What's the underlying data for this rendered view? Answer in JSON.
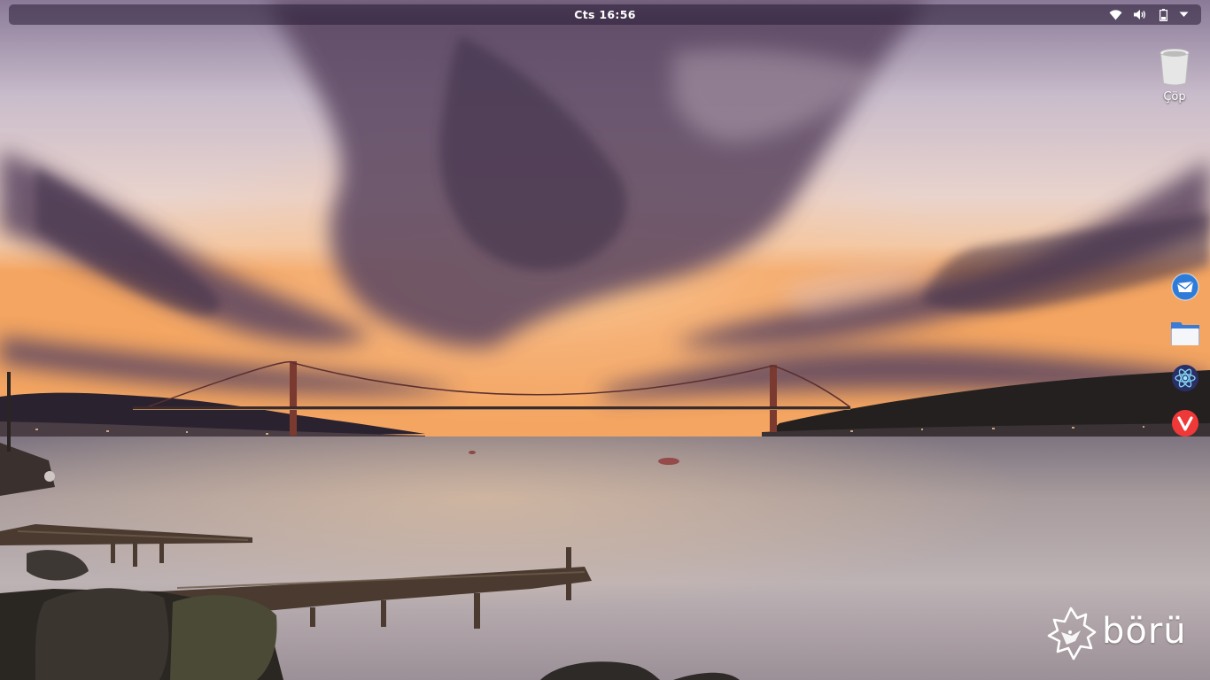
{
  "topbar": {
    "clock": "Cts 16:56",
    "tray_icons": [
      "wifi-icon",
      "volume-icon",
      "battery-icon",
      "dropdown-arrow-icon"
    ]
  },
  "desktop": {
    "trash_label": "Çöp"
  },
  "dock": {
    "items": [
      {
        "icon": "mail-client-icon",
        "color": "#2f7bd8"
      },
      {
        "icon": "file-manager-icon",
        "color": "#3a7bd5"
      },
      {
        "icon": "atom-editor-icon",
        "color": "#2a2f66"
      },
      {
        "icon": "vivaldi-browser-icon",
        "color": "#ef3939"
      }
    ]
  },
  "branding": {
    "logo_text": "börü"
  }
}
